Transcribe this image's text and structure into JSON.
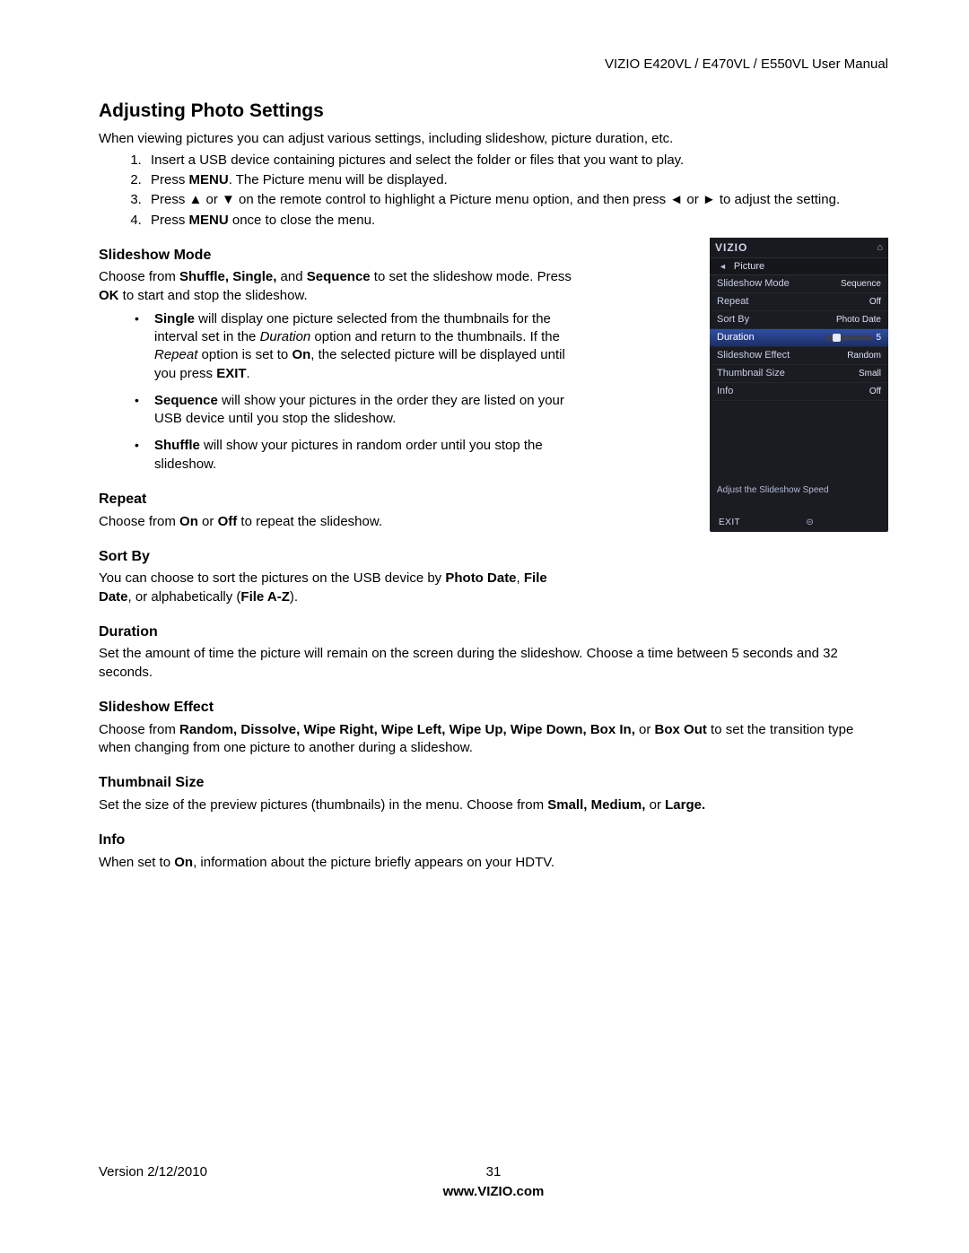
{
  "header": "VIZIO E420VL / E470VL / E550VL User Manual",
  "title": "Adjusting Photo Settings",
  "intro": "When viewing pictures you can adjust various settings, including slideshow, picture duration, etc.",
  "step1": "Insert a USB device containing pictures and select the folder or files that you want to play.",
  "step2a": "Press ",
  "step2b": "MENU",
  "step2c": ". The Picture menu will be displayed.",
  "step3a": "Press ▲ or ▼ on the remote control to highlight a Picture menu option, and then press ◄ or ► to adjust the setting.",
  "step4a": "Press ",
  "step4b": "MENU",
  "step4c": " once to close the menu.",
  "s_slideshow_h": "Slideshow Mode",
  "s_slideshow_p1a": "Choose from ",
  "s_slideshow_p1b": "Shuffle, Single,",
  "s_slideshow_p1c": " and ",
  "s_slideshow_p1d": "Sequence",
  "s_slideshow_p1e": " to set the slideshow mode. Press ",
  "s_slideshow_p1f": "OK",
  "s_slideshow_p1g": " to start and stop the slideshow.",
  "bul_single_b": "Single",
  "bul_single_t1": " will display one picture selected from the thumbnails for the interval set in the ",
  "bul_single_i": "Duration",
  "bul_single_t2": " option and return to the thumbnails. If the ",
  "bul_single_i2": "Repeat",
  "bul_single_t3": " option is set to ",
  "bul_single_b2": "On",
  "bul_single_t4": ", the selected picture will be displayed until you press ",
  "bul_single_b3": "EXIT",
  "bul_single_t5": ".",
  "bul_seq_b": "Sequence",
  "bul_seq_t": " will show your pictures in the order they are listed on your USB device until you stop the slideshow.",
  "bul_shuf_b": "Shuffle",
  "bul_shuf_t": " will show your pictures in random order until you stop the slideshow.",
  "s_repeat_h": "Repeat",
  "s_repeat_p1": "Choose from ",
  "s_repeat_b1": "On",
  "s_repeat_p2": " or ",
  "s_repeat_b2": "Off",
  "s_repeat_p3": " to repeat the slideshow.",
  "s_sort_h": "Sort By",
  "s_sort_p1": "You can choose to sort the pictures on the USB device by ",
  "s_sort_b1": "Photo Date",
  "s_sort_p2": ", ",
  "s_sort_b2": "File Date",
  "s_sort_p3": ", or alphabetically (",
  "s_sort_b3": "File A-Z",
  "s_sort_p4": ").",
  "s_dur_h": "Duration",
  "s_dur_p": "Set the amount of time the picture will remain on the screen during the slideshow. Choose a time between 5 seconds and 32 seconds.",
  "s_eff_h": "Slideshow Effect",
  "s_eff_p1": "Choose from ",
  "s_eff_b1": "Random, Dissolve, Wipe Right, Wipe Left, Wipe Up, Wipe Down, Box In,",
  "s_eff_p2": " or ",
  "s_eff_b2": "Box Out",
  "s_eff_p3": " to set the transition type when changing from one picture to another during a slideshow.",
  "s_thumb_h": "Thumbnail Size",
  "s_thumb_p1": "Set the size of the preview pictures (thumbnails) in the menu. Choose from ",
  "s_thumb_b1": "Small, Medium,",
  "s_thumb_p2": " or ",
  "s_thumb_b2": "Large.",
  "s_info_h": "Info",
  "s_info_p1": "When set to ",
  "s_info_b1": "On",
  "s_info_p2": ", information about the picture briefly appears on your HDTV.",
  "osd": {
    "logo": "VIZIO",
    "sub": "Picture",
    "rows": [
      {
        "label": "Slideshow Mode",
        "value": "Sequence"
      },
      {
        "label": "Repeat",
        "value": "Off"
      },
      {
        "label": "Sort By",
        "value": "Photo Date"
      },
      {
        "label": "Duration",
        "value": "5"
      },
      {
        "label": "Slideshow Effect",
        "value": "Random"
      },
      {
        "label": "Thumbnail Size",
        "value": "Small"
      },
      {
        "label": "Info",
        "value": "Off"
      }
    ],
    "hint": "Adjust the Slideshow Speed",
    "exit": "EXIT"
  },
  "footer": {
    "version": "Version 2/12/2010",
    "page": "31",
    "site": "www.VIZIO.com"
  }
}
